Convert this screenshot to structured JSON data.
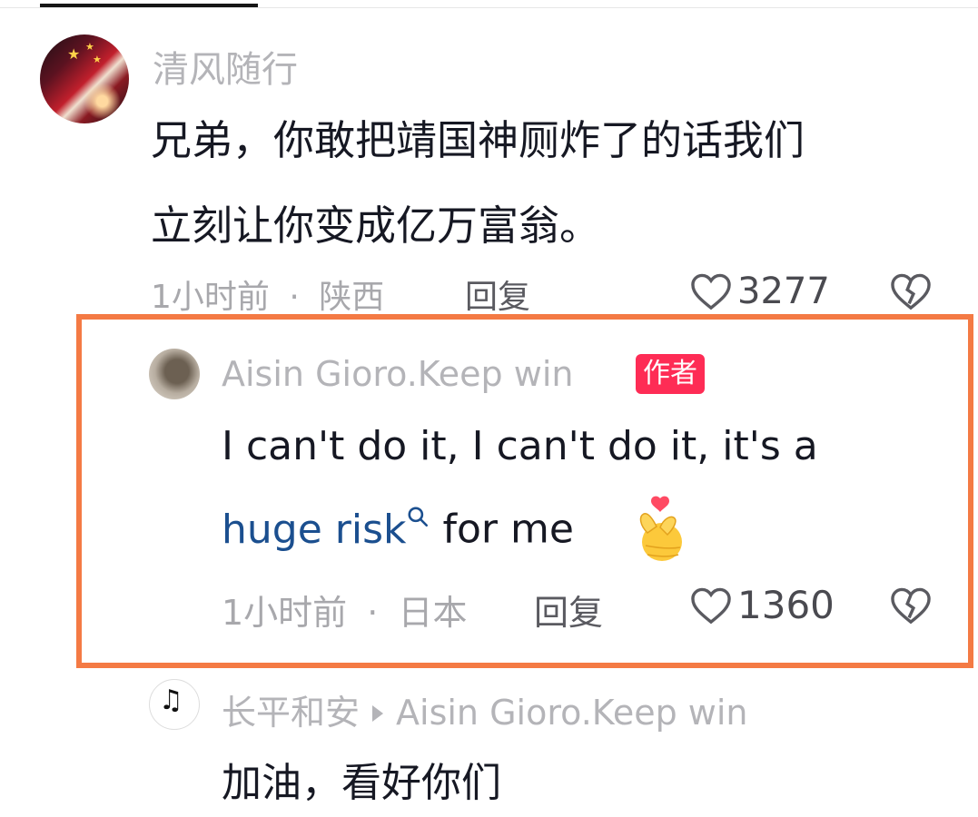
{
  "comments": [
    {
      "nickname": "清风随行",
      "text_line1": "兄弟，你敢把靖国神厕炸了的话我们",
      "text_line2": "立刻让你变成亿万富翁。",
      "time": "1小时前",
      "sep": "·",
      "location": "陕西",
      "reply_label": "回复",
      "likes": "3277"
    }
  ],
  "reply": {
    "nickname": "Aisin Gioro.Keep win",
    "badge": "作者",
    "line1": "I can't do it, I can't do it, it's a",
    "link_text": "huge risk",
    "after_link": " for me",
    "time": "1小时前",
    "sep": "·",
    "location": "日本",
    "reply_label": "回复",
    "likes": "1360"
  },
  "sub_reply": {
    "nickname": "长平和安",
    "reply_to": "Aisin Gioro.Keep win",
    "text": "加油，看好你们"
  },
  "icons": [
    "heart-outline-icon",
    "broken-heart-icon",
    "search-icon",
    "finger-heart-emoji"
  ],
  "colors": {
    "highlight_border": "#f47a44",
    "author_badge": "#fe2c55",
    "link": "#1b4f8f"
  }
}
